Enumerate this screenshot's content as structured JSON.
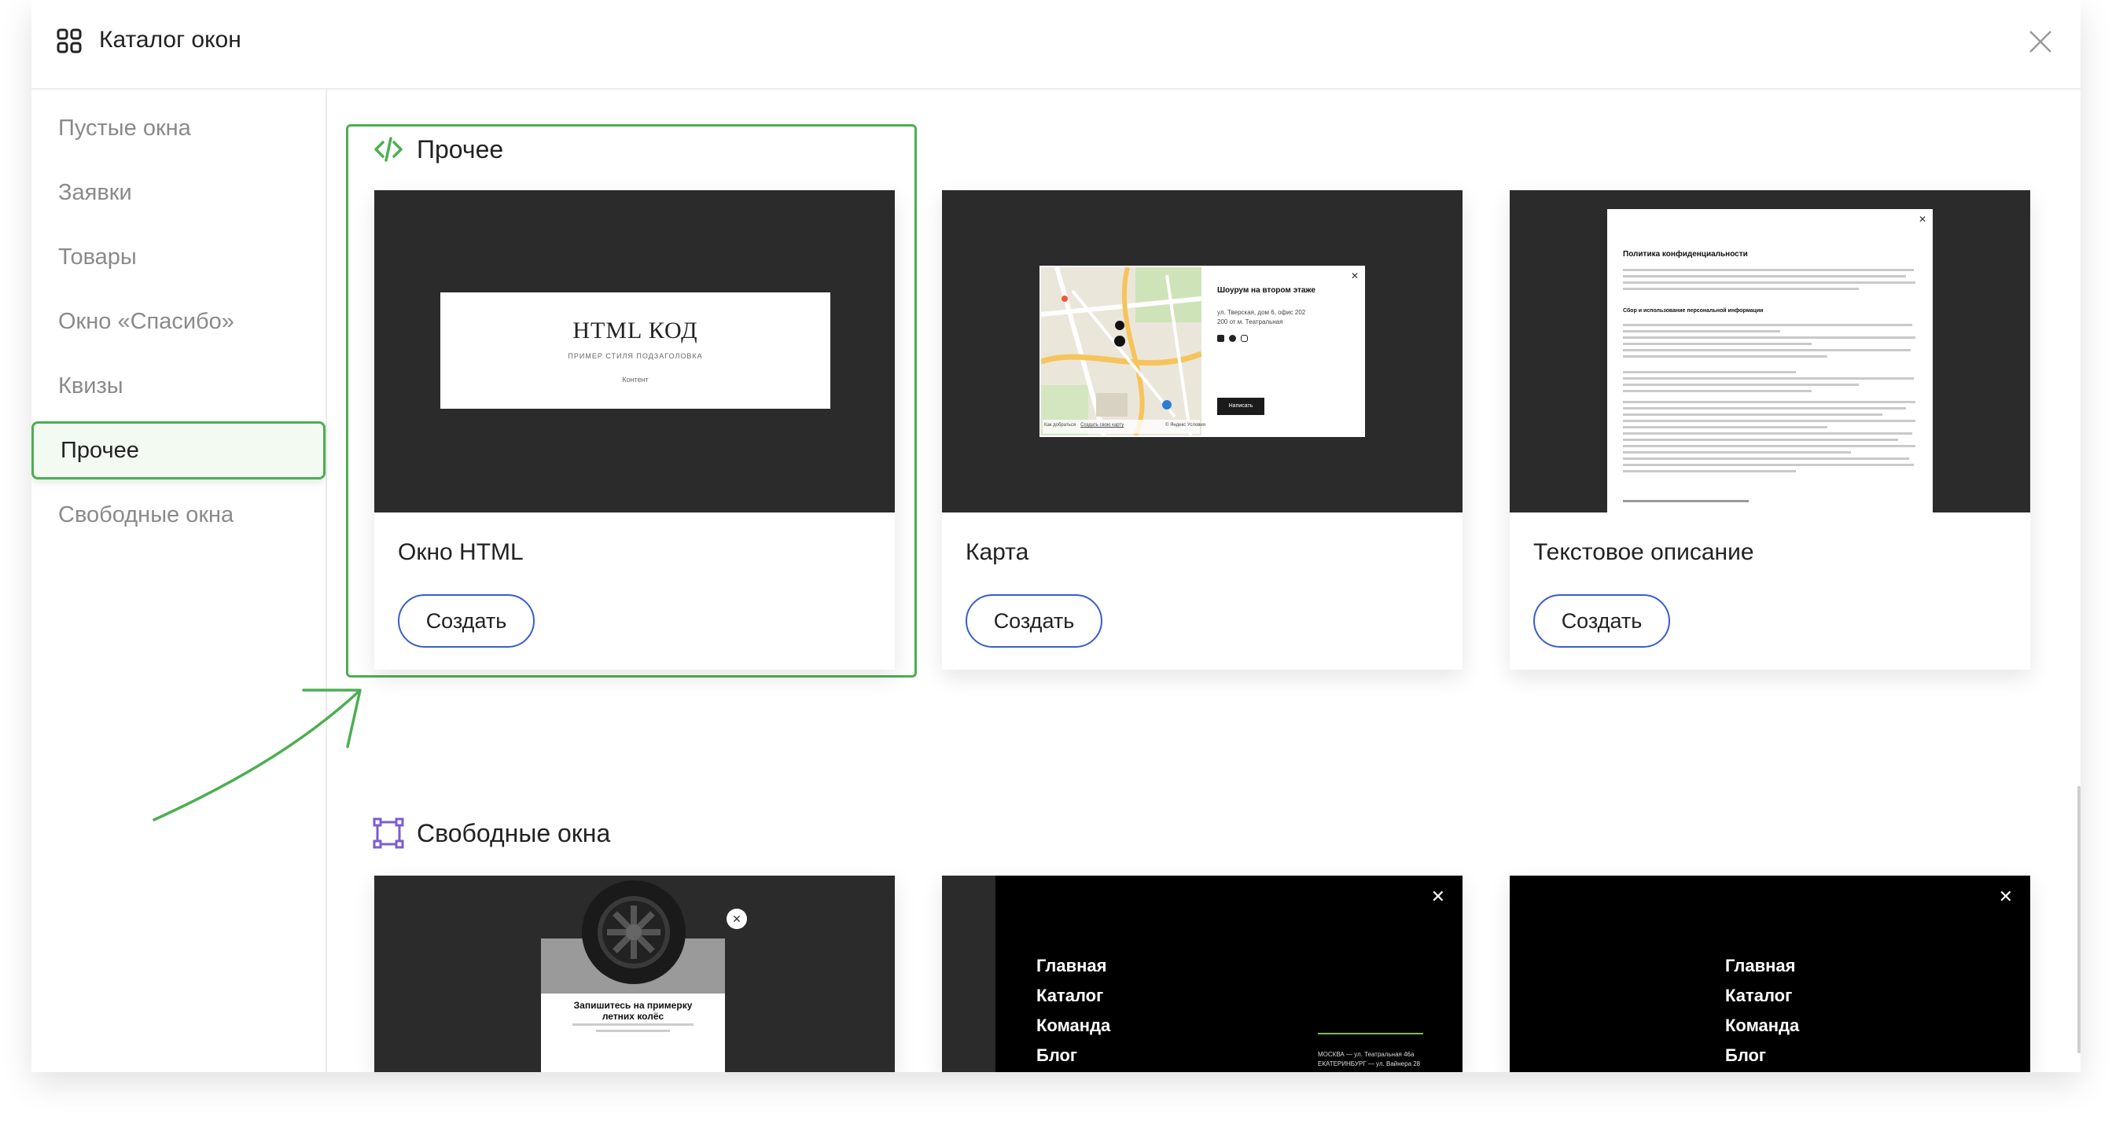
{
  "header": {
    "title": "Каталог окон",
    "grid_icon": "grid-icon",
    "close_icon": "close-icon"
  },
  "sidebar": {
    "items": [
      {
        "label": "Пустые окна"
      },
      {
        "label": "Заявки"
      },
      {
        "label": "Товары"
      },
      {
        "label": "Окно «Спасибо»"
      },
      {
        "label": "Квизы"
      },
      {
        "label": "Прочее",
        "active": true
      },
      {
        "label": "Свободные окна"
      }
    ]
  },
  "sections": {
    "other": {
      "title": "Прочее",
      "icon": "code-icon",
      "cards": [
        {
          "name": "Окно HTML",
          "button": "Создать",
          "preview": {
            "heading": "HTML КОД",
            "subheading": "ПРИМЕР СТИЛЯ ПОДЗАГОЛОВКА",
            "content": "Контент"
          }
        },
        {
          "name": "Карта",
          "button": "Создать",
          "preview": {
            "heading": "Шоурум на втором этаже",
            "address": "ул. Тверская, дом 6, офис 202",
            "metro": "200 от м. Театральная",
            "button": "Написать",
            "route": "Как добраться",
            "create_map": "Создать свою карту",
            "yandex": "© Яндекс Условия"
          }
        },
        {
          "name": "Текстовое описание",
          "button": "Создать",
          "preview": {
            "heading": "Политика конфиденциальности",
            "subheading": "Сбор и использование персональной информации"
          }
        }
      ]
    },
    "free": {
      "title": "Свободные окна",
      "icon": "frame-icon",
      "cards": [
        {
          "preview": {
            "heading": "Запишитесь на примерку летних колёс"
          }
        },
        {
          "preview": {
            "nav": [
              "Главная",
              "Каталог",
              "Команда",
              "Блог"
            ],
            "address_1": "МОСКВА — ул. Театральная 46а",
            "address_2": "ЕКАТЕРИНБУРГ — ул. Вайнера 28"
          }
        },
        {
          "preview": {
            "nav": [
              "Главная",
              "Каталог",
              "Команда",
              "Блог"
            ]
          }
        }
      ]
    }
  },
  "colors": {
    "accent_green": "#4caf50",
    "button_border": "#3a5ccc",
    "thumb_dark": "#2b2b2b"
  }
}
